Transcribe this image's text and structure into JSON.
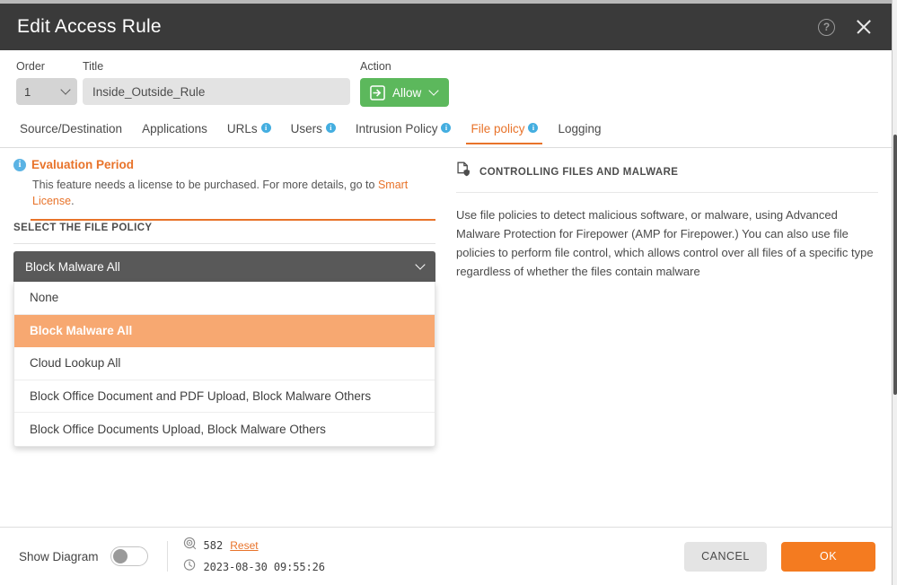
{
  "window": {
    "title": "Edit Access Rule",
    "help_icon": "question-circle-icon",
    "close_icon": "close-icon"
  },
  "form": {
    "order": {
      "label": "Order",
      "value": "1"
    },
    "title": {
      "label": "Title",
      "value": "Inside_Outside_Rule"
    },
    "action": {
      "label": "Action",
      "value": "Allow",
      "color": "#5cb85c",
      "icon": "arrow-into-bracket-icon"
    }
  },
  "tabs": [
    {
      "label": "Source/Destination",
      "badge": false,
      "active": false
    },
    {
      "label": "Applications",
      "badge": false,
      "active": false
    },
    {
      "label": "URLs",
      "badge": true,
      "active": false
    },
    {
      "label": "Users",
      "badge": true,
      "active": false
    },
    {
      "label": "Intrusion Policy",
      "badge": true,
      "active": false
    },
    {
      "label": "File policy",
      "badge": true,
      "active": true
    },
    {
      "label": "Logging",
      "badge": false,
      "active": false
    }
  ],
  "evaluation": {
    "icon": "info-circle-icon",
    "title": "Evaluation Period",
    "text": "This feature needs a license to be purchased. For more details, go to ",
    "link": "Smart License",
    "text_end": ".",
    "accent": "#e8732a"
  },
  "file_policy": {
    "section_label": "SELECT THE FILE POLICY",
    "selected": "Block Malware All",
    "chevron_icon": "chevron-down-icon",
    "options": [
      {
        "label": "None",
        "selected": false
      },
      {
        "label": "Block Malware All",
        "selected": true
      },
      {
        "label": "Cloud Lookup All",
        "selected": false
      },
      {
        "label": "Block Office Document and PDF Upload, Block Malware Others",
        "selected": false
      },
      {
        "label": "Block Office Documents Upload, Block Malware Others",
        "selected": false
      }
    ],
    "highlight_color": "#f7a871"
  },
  "help_panel": {
    "icon": "file-shield-icon",
    "title": "CONTROLLING FILES AND MALWARE",
    "body": "Use file policies to detect malicious software, or malware, using Advanced Malware Protection for Firepower (AMP for Firepower.) You can also use file policies to perform file control, which allows control over all files of a specific type regardless of whether the files contain malware"
  },
  "footer": {
    "show_diagram_label": "Show Diagram",
    "toggle_on": false,
    "hit_count_icon": "target-icon",
    "hit_count": "582",
    "reset_label": "Reset",
    "clock_icon": "clock-icon",
    "timestamp": "2023-08-30 09:55:26",
    "cancel_label": "CANCEL",
    "ok_label": "OK",
    "ok_color": "#f47b20"
  }
}
